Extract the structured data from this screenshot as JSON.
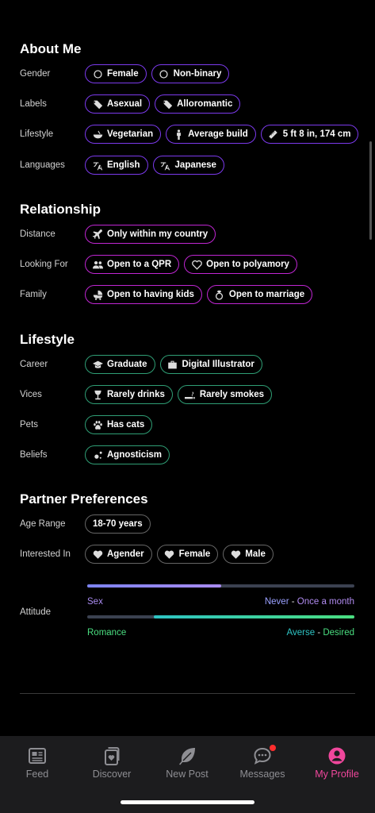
{
  "about": {
    "title": "About Me",
    "gender": {
      "label": "Gender",
      "items": [
        {
          "text": "Female",
          "icon": "circle-icon"
        },
        {
          "text": "Non-binary",
          "icon": "circle-icon"
        }
      ]
    },
    "labels": {
      "label": "Labels",
      "items": [
        {
          "text": "Asexual",
          "icon": "tag-icon"
        },
        {
          "text": "Alloromantic",
          "icon": "tag-icon"
        }
      ]
    },
    "lifestyle": {
      "label": "Lifestyle",
      "items": [
        {
          "text": "Vegetarian",
          "icon": "bowl-icon"
        },
        {
          "text": "Average build",
          "icon": "person-icon"
        },
        {
          "text": "5 ft 8 in, 174 cm",
          "icon": "ruler-icon"
        }
      ]
    },
    "languages": {
      "label": "Languages",
      "items": [
        {
          "text": "English",
          "icon": "translate-icon"
        },
        {
          "text": "Japanese",
          "icon": "translate-icon"
        }
      ]
    }
  },
  "relationship": {
    "title": "Relationship",
    "distance": {
      "label": "Distance",
      "items": [
        {
          "text": "Only within my country",
          "icon": "plane-icon"
        }
      ]
    },
    "looking": {
      "label": "Looking For",
      "items": [
        {
          "text": "Open to a QPR",
          "icon": "people-icon"
        },
        {
          "text": "Open to polyamory",
          "icon": "heart-outline-icon"
        }
      ]
    },
    "family": {
      "label": "Family",
      "items": [
        {
          "text": "Open to having kids",
          "icon": "stroller-icon"
        },
        {
          "text": "Open to marriage",
          "icon": "ring-icon"
        }
      ]
    }
  },
  "lifestyle_sec": {
    "title": "Lifestyle",
    "career": {
      "label": "Career",
      "items": [
        {
          "text": "Graduate",
          "icon": "graduation-cap-icon"
        },
        {
          "text": "Digital Illustrator",
          "icon": "briefcase-icon"
        }
      ]
    },
    "vices": {
      "label": "Vices",
      "items": [
        {
          "text": "Rarely drinks",
          "icon": "wine-glass-icon"
        },
        {
          "text": "Rarely smokes",
          "icon": "cigarette-icon"
        }
      ]
    },
    "pets": {
      "label": "Pets",
      "items": [
        {
          "text": "Has cats",
          "icon": "paw-icon"
        }
      ]
    },
    "beliefs": {
      "label": "Beliefs",
      "items": [
        {
          "text": "Agnosticism",
          "icon": "atom-icon"
        }
      ]
    }
  },
  "partner": {
    "title": "Partner Preferences",
    "age": {
      "label": "Age Range",
      "items": [
        {
          "text": "18-70 years",
          "icon": ""
        }
      ]
    },
    "interested": {
      "label": "Interested In",
      "items": [
        {
          "text": "Agender",
          "icon": "heart-icon"
        },
        {
          "text": "Female",
          "icon": "heart-icon"
        },
        {
          "text": "Male",
          "icon": "heart-icon"
        }
      ]
    },
    "attitude": {
      "label": "Attitude",
      "sex": {
        "name": "Sex",
        "low": "Never",
        "sep": " - ",
        "high": "Once a month",
        "fill_start": 0,
        "fill_end": 0.5,
        "color_from": "#7c83f0",
        "color_to": "#a98bf0"
      },
      "romance": {
        "name": "Romance",
        "low": "Averse",
        "sep": " - ",
        "high": "Desired",
        "fill_start": 0.25,
        "fill_end": 1.0,
        "color_from": "#2ec4c4",
        "color_to": "#4ade80"
      }
    }
  },
  "colors": {
    "purple": "#7c3aed",
    "pink": "#c026d3",
    "green": "#2f9e75",
    "active": "#f0479c"
  },
  "nav": [
    {
      "label": "Feed",
      "icon": "feed-icon",
      "active": false
    },
    {
      "label": "Discover",
      "icon": "discover-icon",
      "active": false
    },
    {
      "label": "New Post",
      "icon": "feather-icon",
      "active": false
    },
    {
      "label": "Messages",
      "icon": "chat-icon",
      "active": false,
      "badge": true
    },
    {
      "label": "My Profile",
      "icon": "profile-icon",
      "active": true
    }
  ]
}
